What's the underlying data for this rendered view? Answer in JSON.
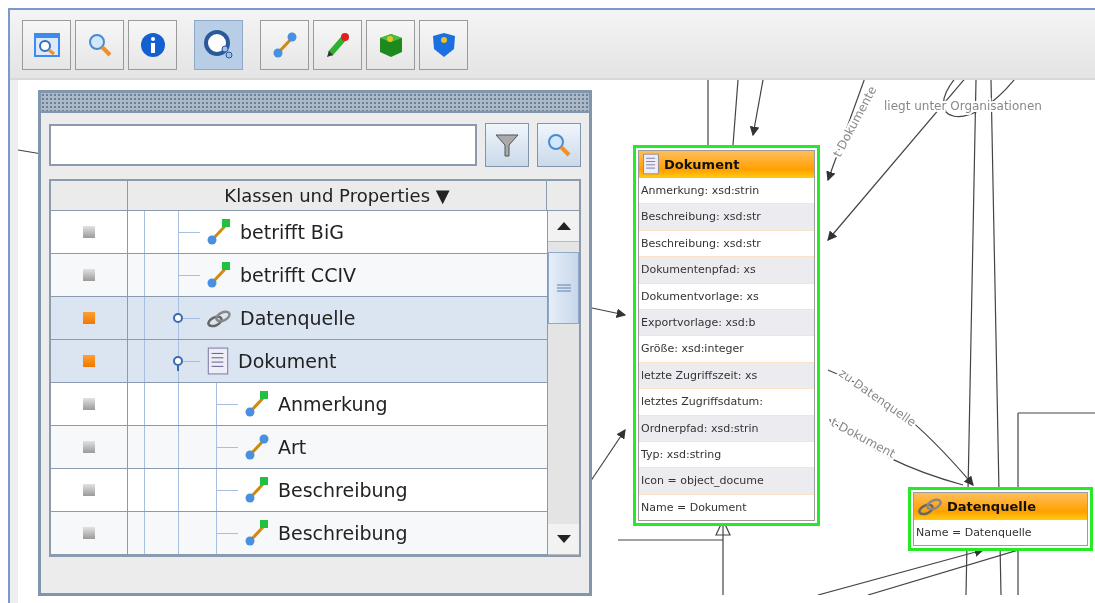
{
  "toolbar": {
    "groups": [
      [
        {
          "kind": "zoomwindow",
          "selected": false
        },
        {
          "kind": "search",
          "selected": false
        },
        {
          "kind": "info",
          "selected": false
        }
      ],
      [
        {
          "kind": "classview",
          "selected": true
        }
      ],
      [
        {
          "kind": "property",
          "selected": false
        },
        {
          "kind": "edit",
          "selected": false
        },
        {
          "kind": "greencube",
          "selected": false
        },
        {
          "kind": "blueshield",
          "selected": false
        }
      ]
    ]
  },
  "panel": {
    "table": {
      "columns": [
        "Klassen und Properties ▼"
      ],
      "tree": [
        {
          "label": "betrifft BiG",
          "kind": "datatype",
          "marked": false,
          "selected": false
        },
        {
          "label": "betrifft CCIV",
          "kind": "datatype",
          "marked": false,
          "selected": false
        },
        {
          "label": "Datenquelle",
          "kind": "linkclass",
          "marked": true,
          "selected": true,
          "expanded": false
        },
        {
          "label": "Dokument",
          "kind": "docclass",
          "marked": true,
          "selected": true,
          "expanded": true,
          "children": [
            {
              "label": "Anmerkung",
              "kind": "datatype",
              "marked": false,
              "selected": false
            },
            {
              "label": "Art",
              "kind": "object",
              "marked": false,
              "selected": false
            },
            {
              "label": "Beschreibung",
              "kind": "datatype",
              "marked": false,
              "selected": false
            },
            {
              "label": "Beschreibung",
              "kind": "datatype",
              "marked": false,
              "selected": false
            }
          ]
        }
      ]
    }
  },
  "diagram": {
    "nodes": [
      {
        "title": "Dokument",
        "kind": "docclass",
        "rows": [
          "Anmerkung:  xsd:strin",
          "Beschreibung:  xsd:str",
          "Beschreibung:  xsd:str",
          "Dokumentenpfad:  xs",
          "Dokumentvorlage:  xs",
          "Exportvorlage:  xsd:b",
          "Größe:  xsd:integer",
          "letzte Zugriffszeit:  xs",
          "letztes Zugriffsdatum:",
          "Ordnerpfad:  xsd:strin",
          "Typ:  xsd:string",
          "Icon = object_docume",
          "Name = Dokument"
        ]
      },
      {
        "title": "Datenquelle",
        "kind": "linkclass",
        "rows": [
          "Name = Datenquelle"
        ]
      }
    ],
    "edge_labels": [
      "liegt unter Organisationen",
      "t Dokumente",
      "zu Datenquelle",
      "t Dokument"
    ]
  }
}
